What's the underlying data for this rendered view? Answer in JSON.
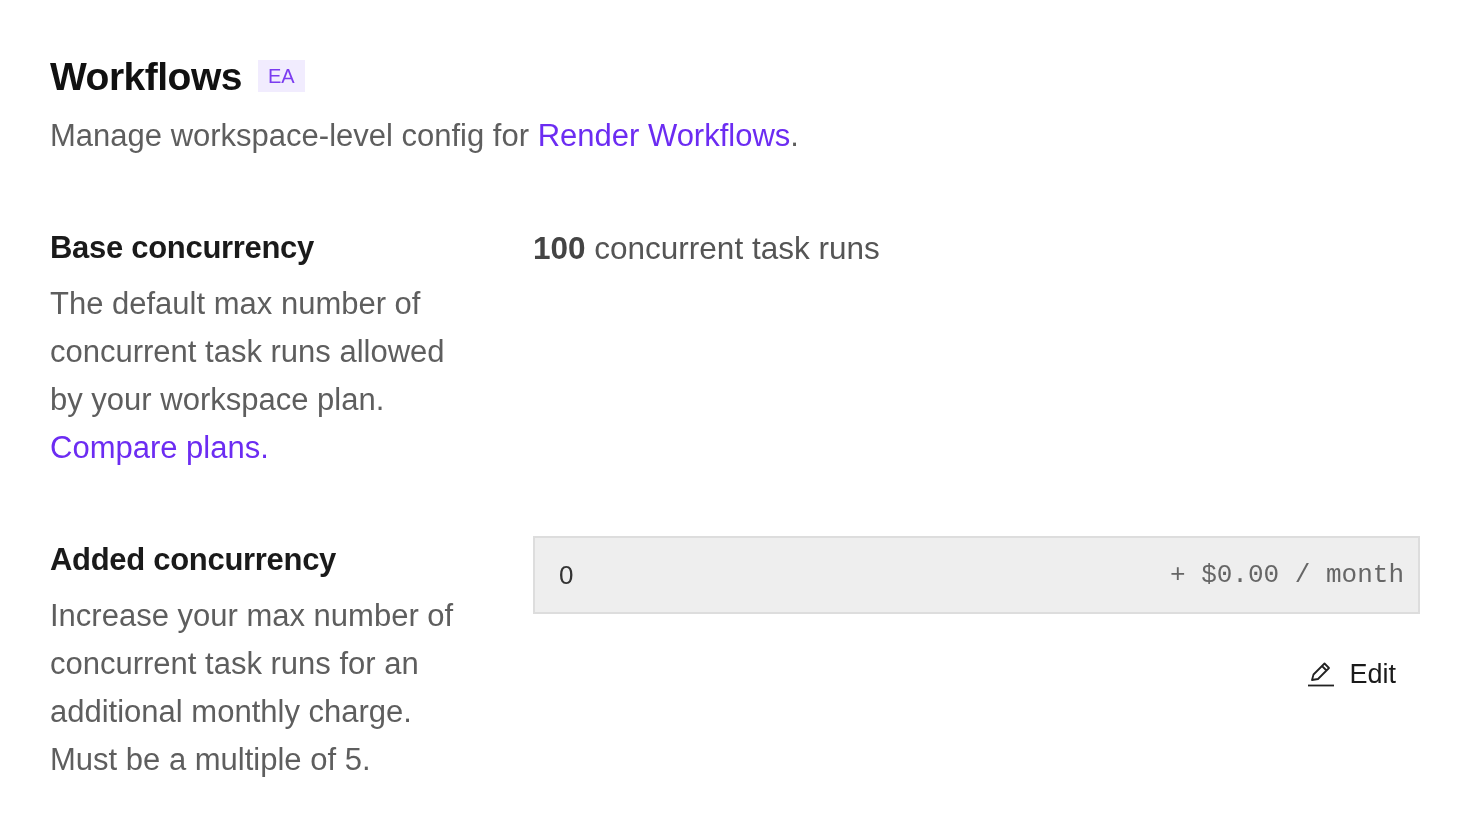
{
  "header": {
    "title": "Workflows",
    "badge": "EA",
    "description": {
      "text": "Manage workspace-level config for ",
      "link": "Render Workflows",
      "after": "."
    }
  },
  "settings": [
    {
      "kind": "static",
      "label": "Base concurrency",
      "description": "The default max number of concurrent task runs allowed by your workspace plan.",
      "link": "Compare plans.",
      "value": "**100** concurrent task runs"
    },
    {
      "kind": "input",
      "label": "Added concurrency",
      "description": "Increase your max number of concurrent task runs for an additional monthly charge. Must be a multiple of 5.",
      "field": {
        "value": "0",
        "suffix": "+ $0.00 / month"
      },
      "button": "Edit"
    }
  ]
}
